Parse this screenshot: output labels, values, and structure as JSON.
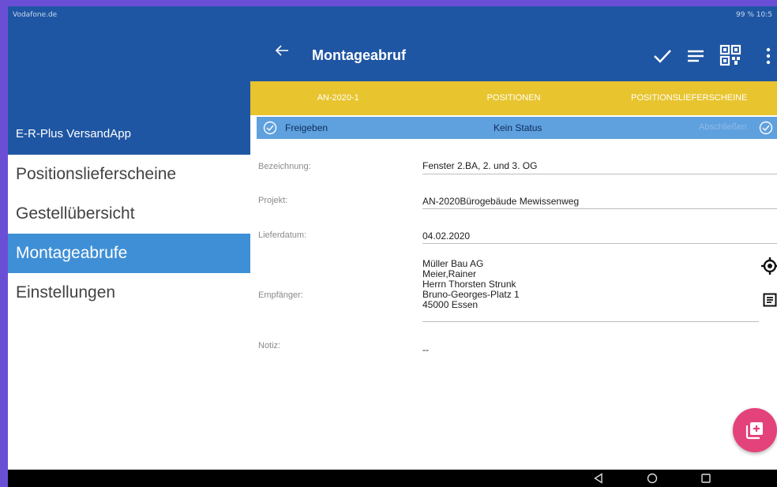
{
  "status_bar": {
    "left_text": "Vodafone.de",
    "right_text": "99 %",
    "time": "10:5"
  },
  "drawer": {
    "app_name": "E-R-Plus VersandApp",
    "items": [
      {
        "label": "Positionslieferscheine",
        "active": false
      },
      {
        "label": "Gestellübersicht",
        "active": false
      },
      {
        "label": "Montageabrufe",
        "active": true
      },
      {
        "label": "Einstellungen",
        "active": false
      }
    ]
  },
  "app_bar": {
    "title": "Montageabruf",
    "icons": [
      "arrow-back-icon",
      "check-icon",
      "list-icon",
      "qr-code-icon",
      "more-vert-icon"
    ]
  },
  "tabs": [
    {
      "label": "AN-2020-1"
    },
    {
      "label": "POSITIONEN"
    },
    {
      "label": "POSITIONSLIEFERSCHEINE"
    }
  ],
  "status_strip": {
    "release_label": "Freigeben",
    "status_label": "Kein Status",
    "finish_label": "Abschließen"
  },
  "form": {
    "bezeichnung": {
      "label": "Bezeichnung:",
      "value": "Fenster 2.BA, 2. und 3. OG"
    },
    "projekt": {
      "label": "Projekt:",
      "value": "AN-2020Bürogebäude Mewissenweg"
    },
    "lieferdatum": {
      "label": "Lieferdatum:",
      "value": "04.02.2020"
    },
    "empfaenger": {
      "label": "Empfänger:",
      "lines": [
        "Müller Bau AG",
        "Meier,Rainer",
        "Herrn Thorsten Strunk",
        "Bruno-Georges-Platz 1",
        "45000 Essen"
      ]
    },
    "notiz": {
      "label": "Notiz:",
      "value": "--"
    }
  },
  "colors": {
    "primary": "#1f56a3",
    "tab_bar": "#e8c42f",
    "status_strip": "#5fa0de",
    "drawer_active": "#3f8fd6",
    "fab": "#e4427a"
  }
}
